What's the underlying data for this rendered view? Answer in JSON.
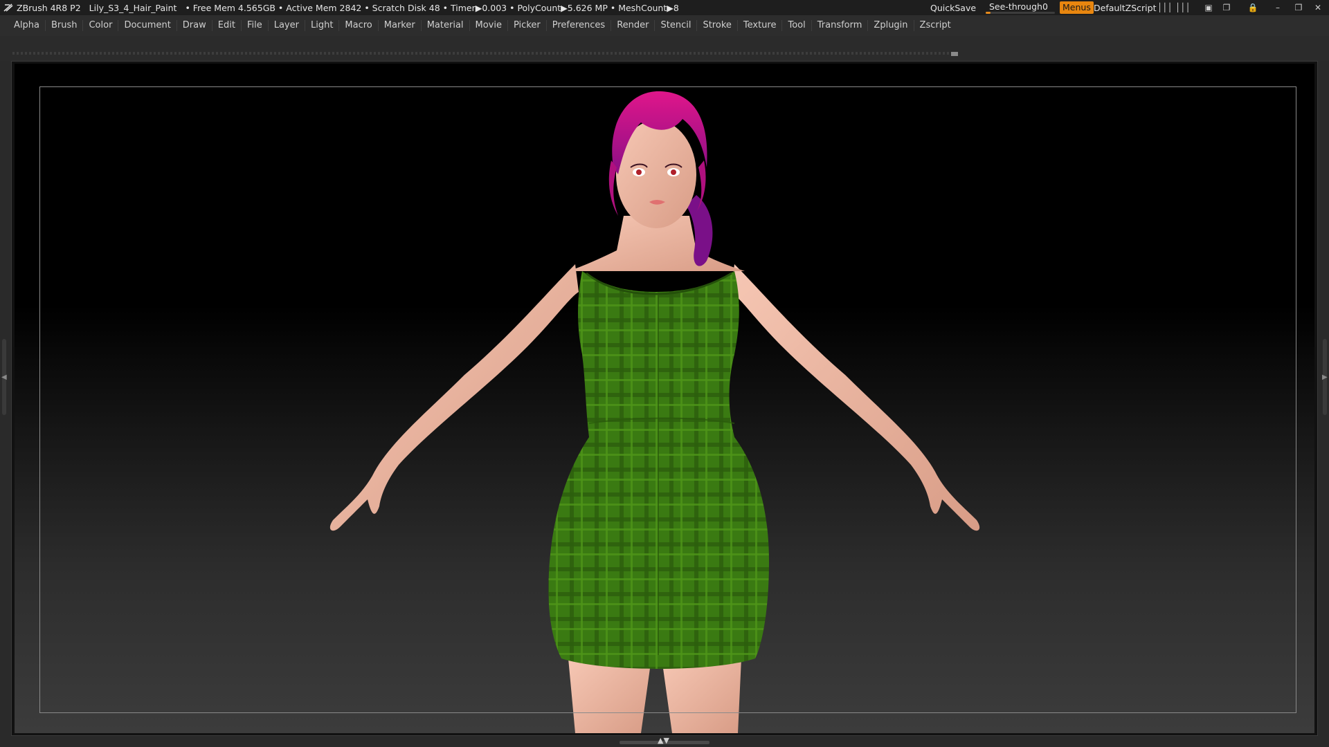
{
  "titlebar": {
    "app_name": "ZBrush 4R8 P2",
    "file_name": "Lily_S3_4_Hair_Paint",
    "stats": "• Free Mem 4.565GB • Active Mem 2842 • Scratch Disk 48 •  Timer▶0.003 • PolyCount▶5.626 MP  • MeshCount▶8",
    "quicksave": "QuickSave",
    "seethrough_label": "See-through",
    "seethrough_value": "0",
    "seethrough_level": 0.07,
    "menus_button": "Menus",
    "default_zscript": "DefaultZScript",
    "accent_color": "#e8860f"
  },
  "menubar": {
    "items": [
      "Alpha",
      "Brush",
      "Color",
      "Document",
      "Draw",
      "Edit",
      "File",
      "Layer",
      "Light",
      "Macro",
      "Marker",
      "Material",
      "Movie",
      "Picker",
      "Preferences",
      "Render",
      "Stencil",
      "Stroke",
      "Texture",
      "Tool",
      "Transform",
      "Zplugin",
      "Zscript"
    ]
  },
  "icons": {
    "title_logo": "zbrush-logo-icon",
    "layout_1": "layout-icon",
    "layout_2": "layout-alt-icon",
    "window_1": "window-icon",
    "window_2": "window-stack-icon",
    "lock": "lock-icon",
    "minimize": "minimize-icon",
    "restore": "restore-icon",
    "close": "close-icon"
  },
  "canvas": {
    "model": "3D character in green plaid dress with magenta hair"
  }
}
